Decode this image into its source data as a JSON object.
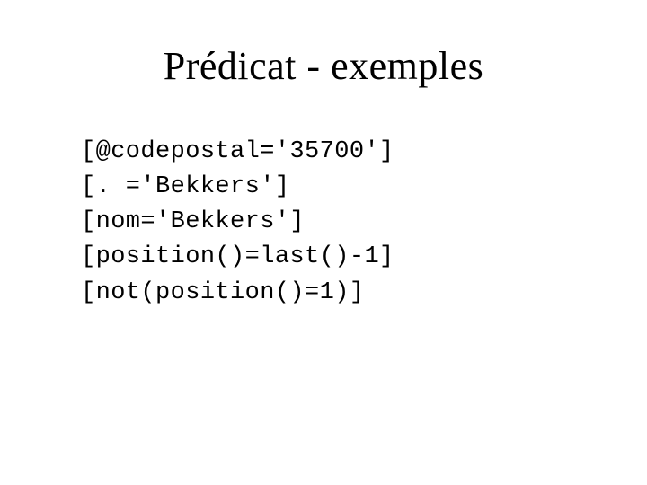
{
  "title": "Prédicat - exemples",
  "lines": [
    "[@codepostal='35700']",
    "[. ='Bekkers']",
    "[nom='Bekkers']",
    "[position()=last()-1]",
    "[not(position()=1)]"
  ]
}
